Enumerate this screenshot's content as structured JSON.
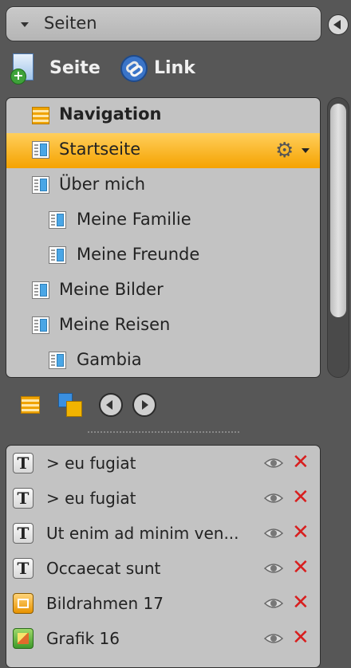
{
  "header": {
    "title": "Seiten"
  },
  "toolbar": {
    "new_page_label": "Seite",
    "link_label": "Link"
  },
  "nav": {
    "items": [
      {
        "label": "Navigation",
        "icon": "navigation-list-icon"
      },
      {
        "label": "Startseite",
        "icon": "page-icon",
        "selected": true
      },
      {
        "label": "Über mich",
        "icon": "page-icon"
      },
      {
        "label": "Meine Familie",
        "icon": "page-icon"
      },
      {
        "label": "Meine Freunde",
        "icon": "page-icon"
      },
      {
        "label": "Meine Bilder",
        "icon": "page-icon"
      },
      {
        "label": "Meine Reisen",
        "icon": "page-icon"
      },
      {
        "label": "Gambia",
        "icon": "page-icon"
      }
    ]
  },
  "elements": {
    "items": [
      {
        "label": "> eu fugiat",
        "type": "text",
        "type_glyph": "T"
      },
      {
        "label": "> eu fugiat",
        "type": "text",
        "type_glyph": "T"
      },
      {
        "label": "Ut enim ad minim ven...",
        "type": "text",
        "type_glyph": "T"
      },
      {
        "label": "Occaecat sunt",
        "type": "text",
        "type_glyph": "T"
      },
      {
        "label": "Bildrahmen 17",
        "type": "frame",
        "type_glyph": ""
      },
      {
        "label": "Grafik 16",
        "type": "image",
        "type_glyph": ""
      }
    ]
  },
  "colors": {
    "selected_bg": "#f5a300",
    "delete": "#d81e1e",
    "panel_bg": "#c3c3c3",
    "background": "#575757"
  }
}
